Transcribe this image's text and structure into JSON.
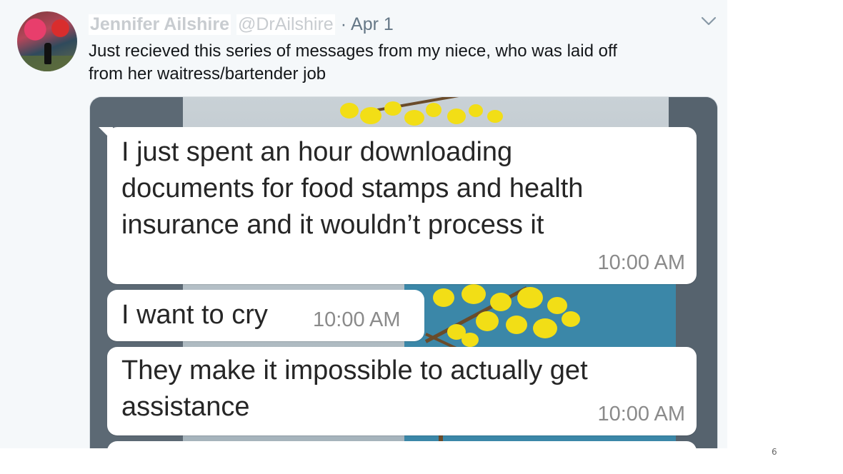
{
  "tweet": {
    "display_name": "Jennifer Ailshire",
    "handle": "@DrAilshire",
    "separator": "·",
    "date": "Apr 1",
    "text_line1": "Just recieved this series of messages from my niece, who was laid off",
    "text_line2": "from her waitress/bartender job",
    "menu_icon": "chevron-down-icon"
  },
  "messages": [
    {
      "lines": [
        "I just spent an hour downloading",
        "documents for food stamps and health",
        "insurance and it wouldn’t process it"
      ],
      "time": "10:00 AM"
    },
    {
      "lines": [
        "I want to cry"
      ],
      "time": "10:00 AM"
    },
    {
      "lines": [
        "They make it impossible to actually get",
        "assistance"
      ],
      "time": "10:00 AM"
    }
  ],
  "page_number": "6",
  "colors": {
    "card_bg": "#f5f8fa",
    "secondary_text": "#657786",
    "blossom": "#f2de16",
    "sky": "#3b87a8"
  }
}
